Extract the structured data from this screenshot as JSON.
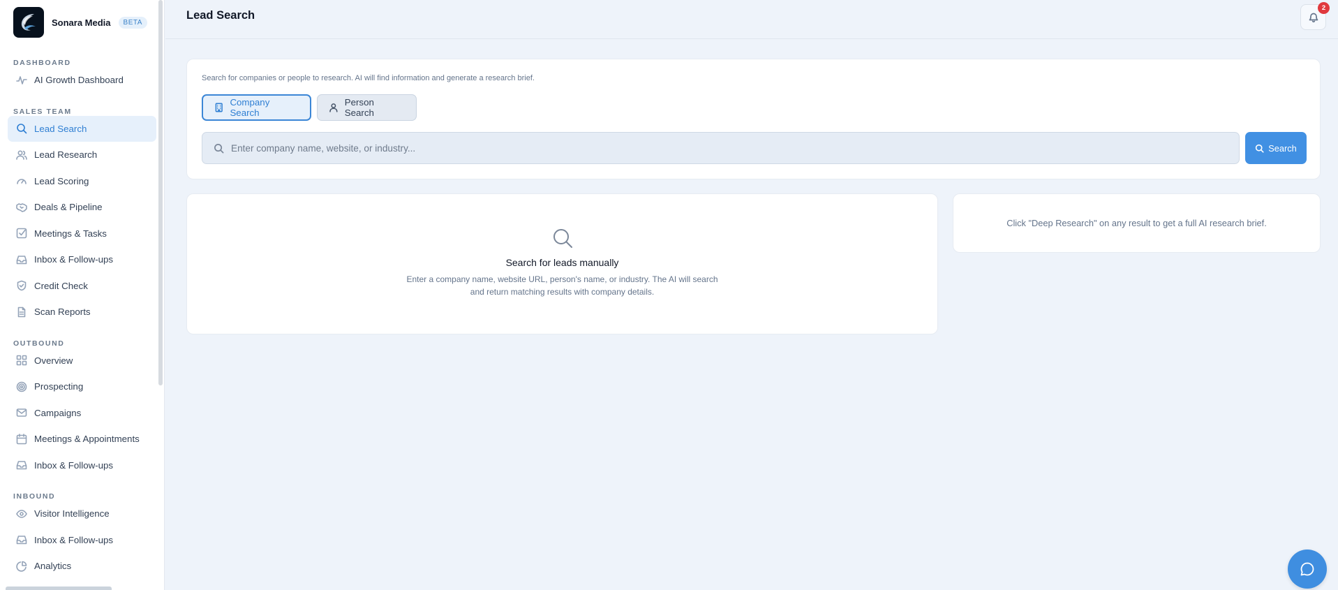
{
  "brand": {
    "name": "Sonara Media",
    "badge": "BETA"
  },
  "sidebar": {
    "sections": [
      {
        "title": "DASHBOARD",
        "items": [
          {
            "label": "AI Growth Dashboard",
            "icon": "activity-icon"
          }
        ]
      },
      {
        "title": "SALES TEAM",
        "items": [
          {
            "label": "Lead Search",
            "icon": "search-icon",
            "active": true
          },
          {
            "label": "Lead Research",
            "icon": "users-icon"
          },
          {
            "label": "Lead Scoring",
            "icon": "gauge-icon"
          },
          {
            "label": "Deals & Pipeline",
            "icon": "handshake-icon"
          },
          {
            "label": "Meetings & Tasks",
            "icon": "check-square-icon"
          },
          {
            "label": "Inbox & Follow-ups",
            "icon": "inbox-icon"
          },
          {
            "label": "Credit Check",
            "icon": "shield-check-icon"
          },
          {
            "label": "Scan Reports",
            "icon": "file-text-icon"
          }
        ]
      },
      {
        "title": "OUTBOUND",
        "items": [
          {
            "label": "Overview",
            "icon": "grid-icon"
          },
          {
            "label": "Prospecting",
            "icon": "target-icon"
          },
          {
            "label": "Campaigns",
            "icon": "mail-icon"
          },
          {
            "label": "Meetings & Appointments",
            "icon": "calendar-icon"
          },
          {
            "label": "Inbox & Follow-ups",
            "icon": "inbox-icon"
          }
        ]
      },
      {
        "title": "INBOUND",
        "items": [
          {
            "label": "Visitor Intelligence",
            "icon": "eye-icon"
          },
          {
            "label": "Inbox & Follow-ups",
            "icon": "inbox-icon"
          },
          {
            "label": "Analytics",
            "icon": "pie-chart-icon"
          }
        ]
      }
    ]
  },
  "header": {
    "title": "Lead Search",
    "notifications_count": "2"
  },
  "search": {
    "intro": "Search for companies or people to research. AI will find information and generate a research brief.",
    "tabs": [
      {
        "label": "Company Search",
        "active": true
      },
      {
        "label": "Person Search",
        "active": false
      }
    ],
    "placeholder": "Enter company name, website, or industry...",
    "value": "",
    "button_label": "Search"
  },
  "results": {
    "empty_title": "Search for leads manually",
    "empty_description": "Enter a company name, website URL, person's name, or industry. The AI will search and return matching results with company details."
  },
  "research_brief": {
    "hint": "Click \"Deep Research\" on any result to get a full AI research brief."
  },
  "colors": {
    "accent": "#4190e3",
    "active_bg": "#e6f0fb",
    "badge_red": "#e0393e",
    "page_bg": "#eef3fa"
  }
}
